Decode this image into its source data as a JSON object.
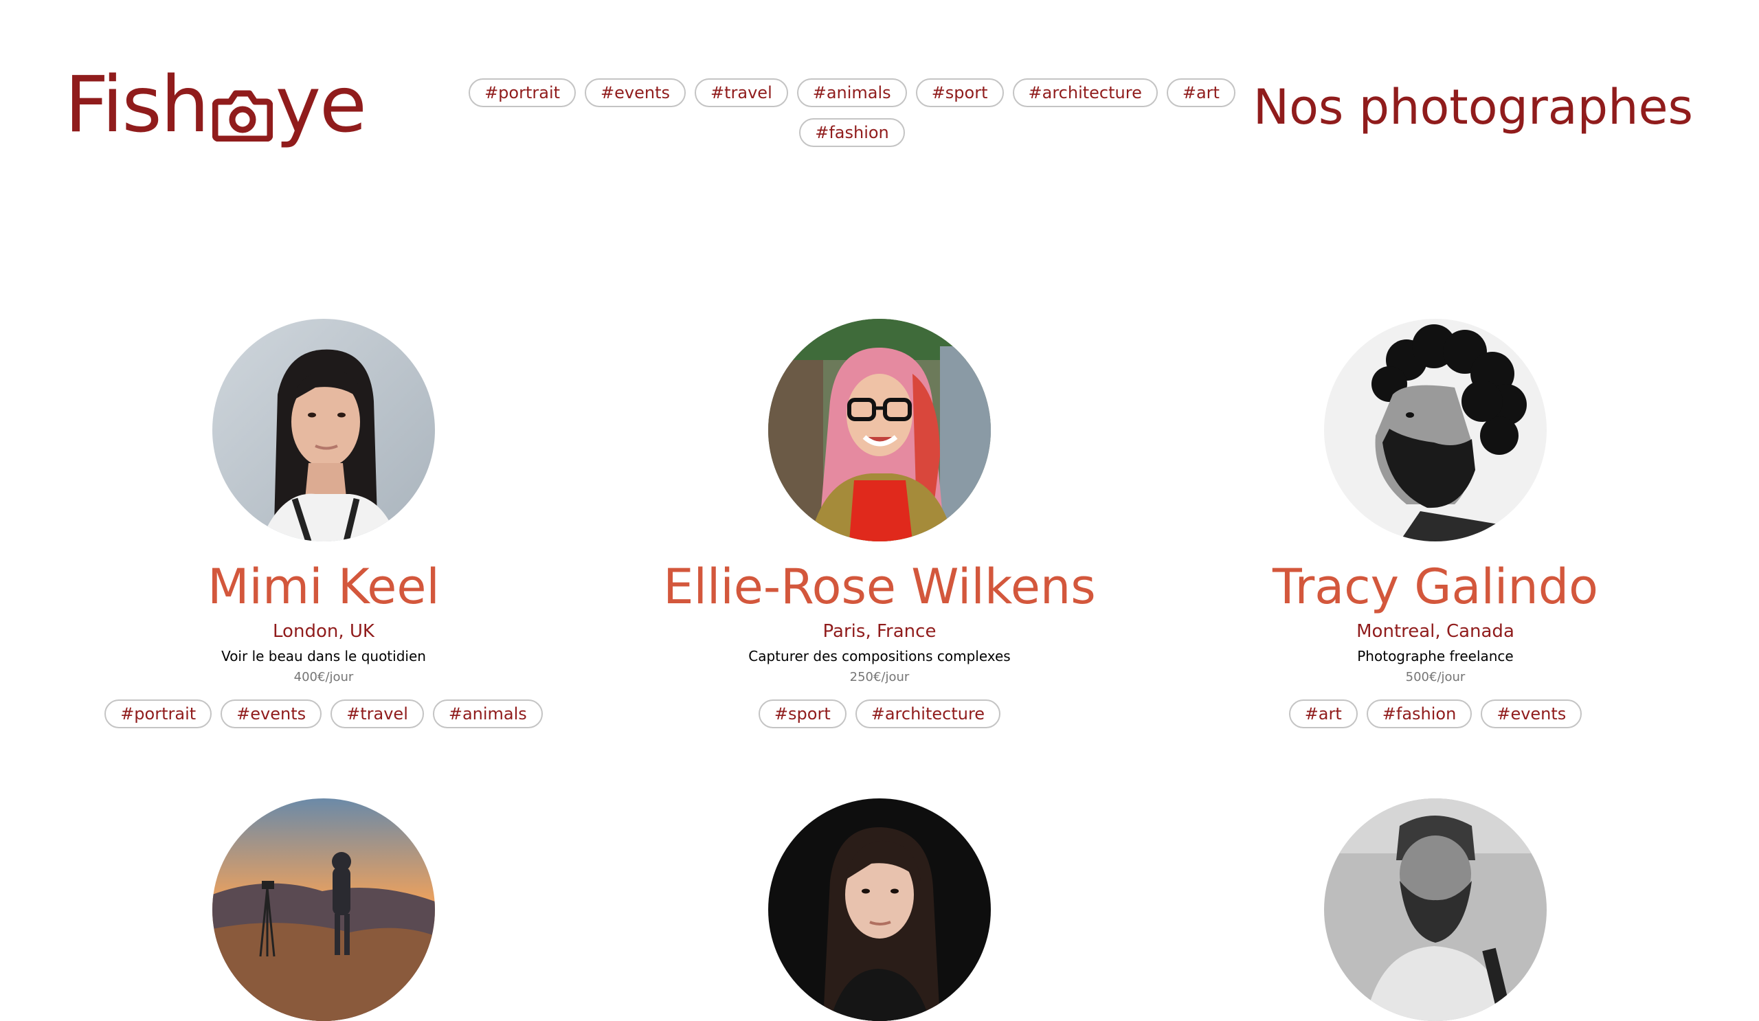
{
  "brand": {
    "name_prefix": "Fish",
    "name_suffix": "ye",
    "logo_color": "#901C1C"
  },
  "page_title": "Nos photographes",
  "nav_tags": [
    "#portrait",
    "#events",
    "#travel",
    "#animals",
    "#sport",
    "#architecture",
    "#art",
    "#fashion"
  ],
  "colors": {
    "primary": "#901C1C",
    "secondary": "#D3573C",
    "tag_border": "#c4c4c4",
    "price": "#757575"
  },
  "photographers": [
    {
      "name": "Mimi Keel",
      "location": "London, UK",
      "tagline": "Voir le beau dans le quotidien",
      "price": "400€/jour",
      "tags": [
        "#portrait",
        "#events",
        "#travel",
        "#animals"
      ],
      "portrait_icon": "portrait-woman-dark-hair"
    },
    {
      "name": "Ellie-Rose Wilkens",
      "location": "Paris, France",
      "tagline": "Capturer des compositions complexes",
      "price": "250€/jour",
      "tags": [
        "#sport",
        "#architecture"
      ],
      "portrait_icon": "portrait-woman-pink-hair-glasses"
    },
    {
      "name": "Tracy Galindo",
      "location": "Montreal, Canada",
      "tagline": "Photographe freelance",
      "price": "500€/jour",
      "tags": [
        "#art",
        "#fashion",
        "#events"
      ],
      "portrait_icon": "portrait-man-curly-beard"
    },
    {
      "portrait_icon": "portrait-landscape-sunset-photographer"
    },
    {
      "portrait_icon": "portrait-woman-dark-background"
    },
    {
      "portrait_icon": "portrait-man-beard-grayscale"
    }
  ]
}
